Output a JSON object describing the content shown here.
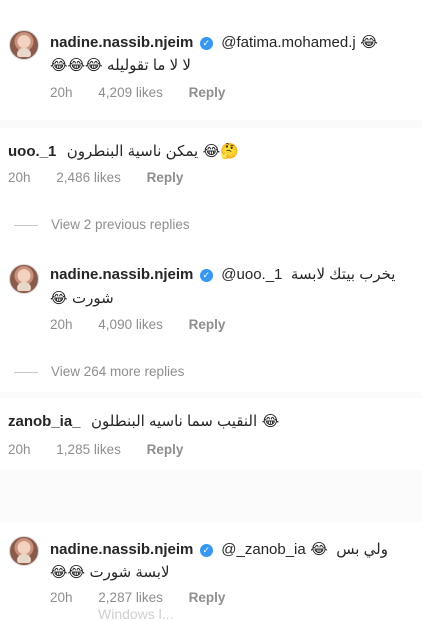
{
  "comments": [
    {
      "username": "nadine.nassib.njeim",
      "mention": "@fatima.mohamed.j",
      "emoji_end": "😂",
      "line2_text": "لا لا ما تقوليله",
      "line2_emojis": "😂😂😂",
      "time": "20h",
      "likes": "4,209 likes",
      "reply": "Reply"
    },
    {
      "username": "uoo._1",
      "text": "يمكن ناسية البنطرون",
      "emojis": "😂🤔",
      "time": "20h",
      "likes": "2,486 likes",
      "reply": "Reply"
    },
    {
      "view_replies": "View 2 previous replies"
    },
    {
      "username": "nadine.nassib.njeim",
      "mention": "@uoo._1",
      "text_end": "يخرب بيتك لابسة",
      "line2_text": "شورت",
      "line2_emojis": "😂",
      "time": "20h",
      "likes": "4,090 likes",
      "reply": "Reply"
    },
    {
      "view_replies": "View 264 more replies"
    },
    {
      "username": "zanob_ia_",
      "text": "النقيب سما ناسيه البنطلون",
      "emojis": "😂",
      "time": "20h",
      "likes": "1,285 likes",
      "reply": "Reply"
    },
    {
      "username": "nadine.nassib.njeim",
      "mention": "@_zanob_ia",
      "emoji_mid": "😂",
      "text_end": "ولي بس",
      "line2_text": "لابسة شورت",
      "line2_emojis": "😂😂",
      "time": "20h",
      "likes": "2,287 likes",
      "reply": "Reply"
    }
  ],
  "verified_glyph": "✓",
  "watermark": "Windows l..."
}
